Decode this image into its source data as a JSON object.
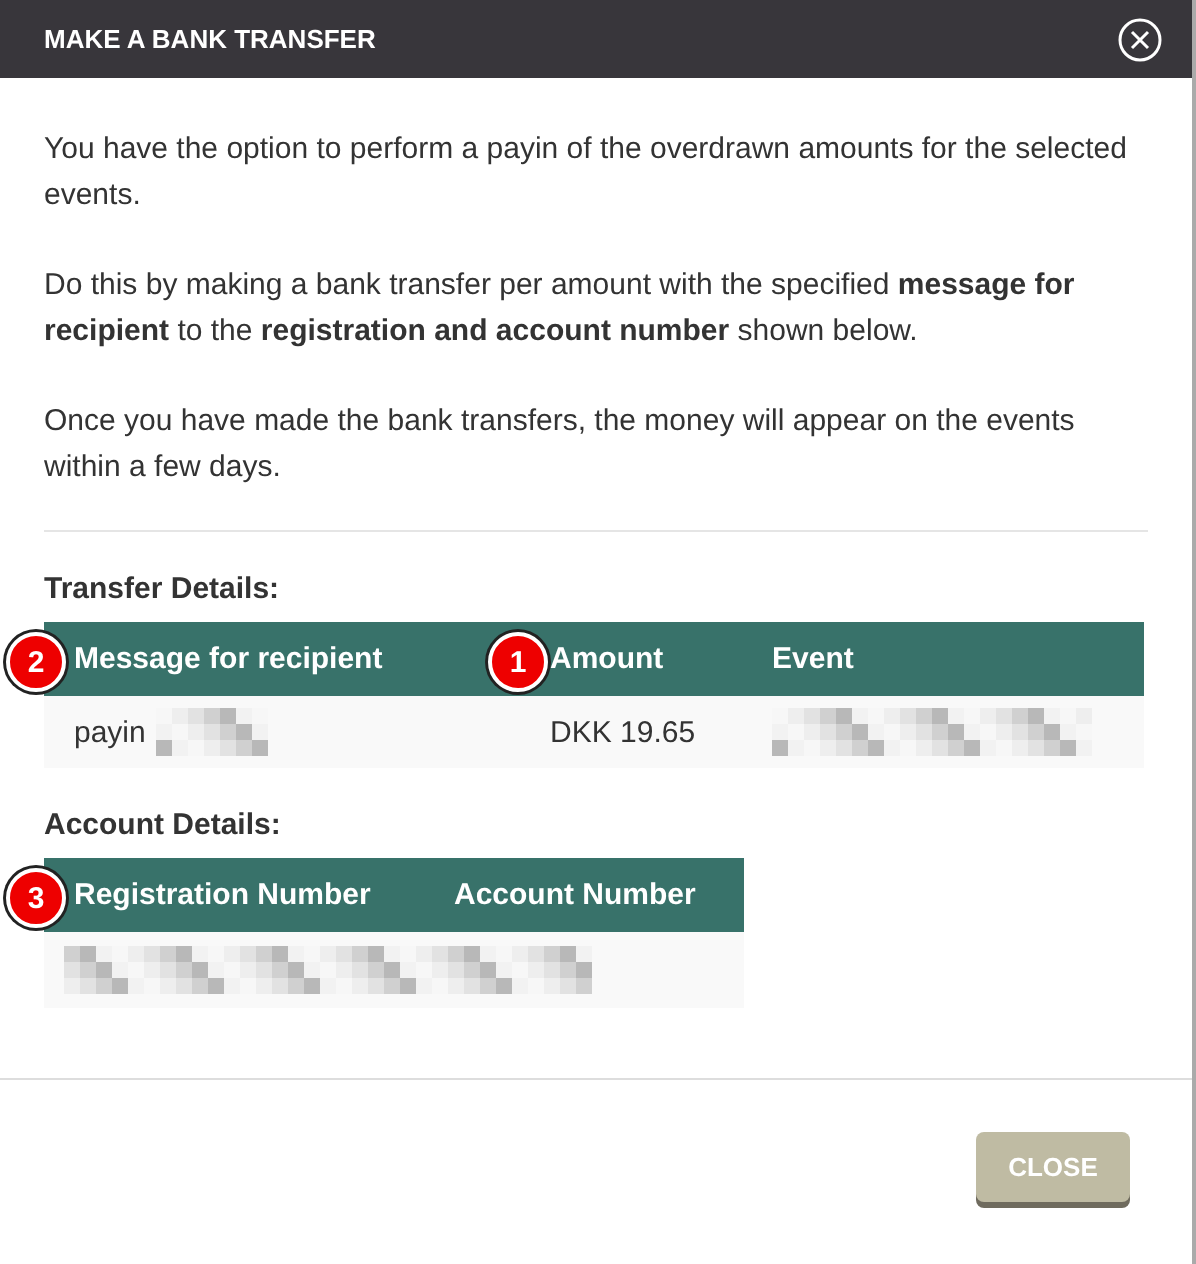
{
  "dialog": {
    "title": "MAKE A BANK TRANSFER",
    "paragraphs": [
      "You have the option to perform a payin of the overdrawn amounts for the selected events.",
      "Do this by making a bank transfer per amount with the specified **message for recipient** to the **registration and account number** shown below.",
      "Once you have made the bank transfers, the money will appear on the events within a few days."
    ],
    "sections": [
      {
        "heading": "Transfer Details:",
        "columns": [
          {
            "label": "Message for recipient",
            "badge": "2"
          },
          {
            "label": "Amount",
            "badge": "1"
          },
          {
            "label": "Event"
          }
        ],
        "row": [
          {
            "kind": "text-redacted",
            "text": "payin"
          },
          {
            "kind": "text",
            "text": "DKK 19.65"
          },
          {
            "kind": "redacted"
          }
        ]
      },
      {
        "heading": "Account Details:",
        "columns": [
          {
            "label": "Registration Number",
            "badge": "3"
          },
          {
            "label": "Account Number"
          }
        ],
        "row": [
          {
            "kind": "redacted"
          }
        ]
      }
    ],
    "buttons": [
      {
        "label": "CLOSE"
      }
    ]
  }
}
